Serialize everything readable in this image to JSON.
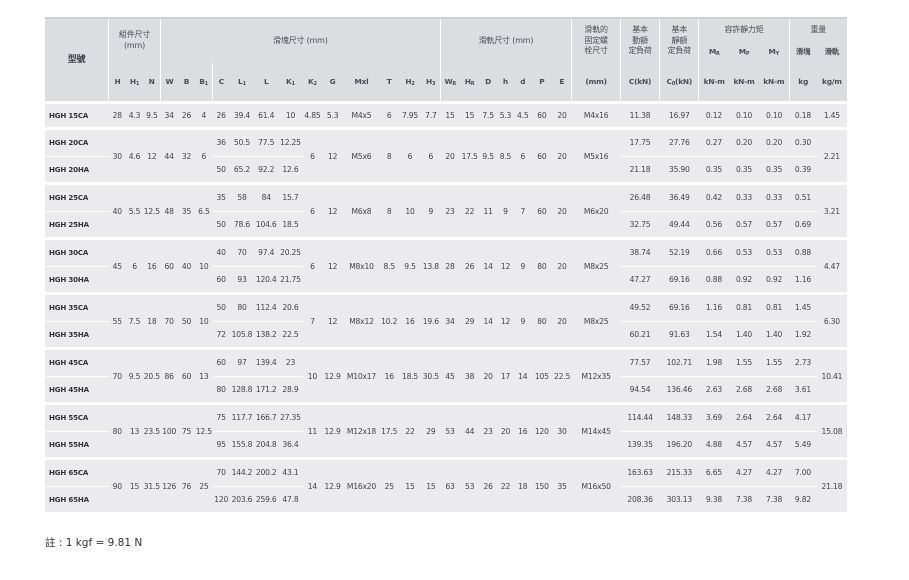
{
  "header": {
    "model": "型號",
    "assembly": "組件尺寸\n(mm)",
    "block": "滑塊尺寸 (mm)",
    "rail": "滑軌尺寸 (mm)",
    "bolt": "滑軌的\n固定螺\n栓尺寸",
    "dynamic": "基本\n動額\n定負荷",
    "static": "基本\n靜額\n定負荷",
    "moment": "容許靜力矩",
    "weight": "重量",
    "block_w": "滑塊",
    "rail_w": "滑軌",
    "mr": "MR",
    "mp": "MP",
    "my": "MY"
  },
  "columns": [
    "H",
    "H1",
    "N",
    "W",
    "B",
    "B1",
    "C",
    "L1",
    "L",
    "K1",
    "K2",
    "G",
    "Mxl",
    "T",
    "H2",
    "H3",
    "WR",
    "HR",
    "D",
    "h",
    "d",
    "P",
    "E",
    "(mm)",
    "C(kN)",
    "C0(kN)",
    "kN-m",
    "kN-m",
    "kN-m",
    "kg",
    "kg/m"
  ],
  "groups": [
    {
      "rows": [
        [
          "HGH 15CA",
          "28",
          "4.3",
          "9.5",
          "34",
          "26",
          "4",
          "26",
          "39.4",
          "61.4",
          "10",
          "4.85",
          "5.3",
          "M4x5",
          "6",
          "7.95",
          "7.7",
          "15",
          "15",
          "7.5",
          "5.3",
          "4.5",
          "60",
          "20",
          "M4x16",
          "11.38",
          "16.97",
          "0.12",
          "0.10",
          "0.10",
          "0.18",
          "1.45"
        ]
      ]
    },
    {
      "shared": {
        "H": "30",
        "H1": "4.6",
        "N": "12",
        "W": "44",
        "B": "32",
        "B1": "6",
        "K2": "6",
        "G": "12",
        "Mxl": "M5x6",
        "T": "8",
        "H2": "6",
        "H3": "6",
        "WR": "20",
        "HR": "17.5",
        "D": "9.5",
        "h": "8.5",
        "d": "6",
        "P": "60",
        "E": "20",
        "bolt": "M5x16",
        "rail_w": "2.21"
      },
      "rows": [
        {
          "model": "HGH 20CA",
          "C": "36",
          "L1": "50.5",
          "L": "77.5",
          "K1": "12.25",
          "Cd": "17.75",
          "C0": "27.76",
          "MR": "0.27",
          "MP": "0.20",
          "MY": "0.20",
          "kg": "0.30"
        },
        {
          "model": "HGH 20HA",
          "C": "50",
          "L1": "65.2",
          "L": "92.2",
          "K1": "12.6",
          "Cd": "21.18",
          "C0": "35.90",
          "MR": "0.35",
          "MP": "0.35",
          "MY": "0.35",
          "kg": "0.39"
        }
      ]
    },
    {
      "shared": {
        "H": "40",
        "H1": "5.5",
        "N": "12.5",
        "W": "48",
        "B": "35",
        "B1": "6.5",
        "K2": "6",
        "G": "12",
        "Mxl": "M6x8",
        "T": "8",
        "H2": "10",
        "H3": "9",
        "WR": "23",
        "HR": "22",
        "D": "11",
        "h": "9",
        "d": "7",
        "P": "60",
        "E": "20",
        "bolt": "M6x20",
        "rail_w": "3.21"
      },
      "rows": [
        {
          "model": "HGH 25CA",
          "C": "35",
          "L1": "58",
          "L": "84",
          "K1": "15.7",
          "Cd": "26.48",
          "C0": "36.49",
          "MR": "0.42",
          "MP": "0.33",
          "MY": "0.33",
          "kg": "0.51"
        },
        {
          "model": "HGH 25HA",
          "C": "50",
          "L1": "78.6",
          "L": "104.6",
          "K1": "18.5",
          "Cd": "32.75",
          "C0": "49.44",
          "MR": "0.56",
          "MP": "0.57",
          "MY": "0.57",
          "kg": "0.69"
        }
      ]
    },
    {
      "shared": {
        "H": "45",
        "H1": "6",
        "N": "16",
        "W": "60",
        "B": "40",
        "B1": "10",
        "K2": "6",
        "G": "12",
        "Mxl": "M8x10",
        "T": "8.5",
        "H2": "9.5",
        "H3": "13.8",
        "WR": "28",
        "HR": "26",
        "D": "14",
        "h": "12",
        "d": "9",
        "P": "80",
        "E": "20",
        "bolt": "M8x25",
        "rail_w": "4.47"
      },
      "rows": [
        {
          "model": "HGH 30CA",
          "C": "40",
          "L1": "70",
          "L": "97.4",
          "K1": "20.25",
          "Cd": "38.74",
          "C0": "52.19",
          "MR": "0.66",
          "MP": "0.53",
          "MY": "0.53",
          "kg": "0.88"
        },
        {
          "model": "HGH 30HA",
          "C": "60",
          "L1": "93",
          "L": "120.4",
          "K1": "21.75",
          "Cd": "47.27",
          "C0": "69.16",
          "MR": "0.88",
          "MP": "0.92",
          "MY": "0.92",
          "kg": "1.16"
        }
      ]
    },
    {
      "shared": {
        "H": "55",
        "H1": "7.5",
        "N": "18",
        "W": "70",
        "B": "50",
        "B1": "10",
        "K2": "7",
        "G": "12",
        "Mxl": "M8x12",
        "T": "10.2",
        "H2": "16",
        "H3": "19.6",
        "WR": "34",
        "HR": "29",
        "D": "14",
        "h": "12",
        "d": "9",
        "P": "80",
        "E": "20",
        "bolt": "M8x25",
        "rail_w": "6.30"
      },
      "rows": [
        {
          "model": "HGH 35CA",
          "C": "50",
          "L1": "80",
          "L": "112.4",
          "K1": "20.6",
          "Cd": "49.52",
          "C0": "69.16",
          "MR": "1.16",
          "MP": "0.81",
          "MY": "0.81",
          "kg": "1.45"
        },
        {
          "model": "HGH 35HA",
          "C": "72",
          "L1": "105.8",
          "L": "138.2",
          "K1": "22.5",
          "Cd": "60.21",
          "C0": "91.63",
          "MR": "1.54",
          "MP": "1.40",
          "MY": "1.40",
          "kg": "1.92"
        }
      ]
    },
    {
      "shared": {
        "H": "70",
        "H1": "9.5",
        "N": "20.5",
        "W": "86",
        "B": "60",
        "B1": "13",
        "K2": "10",
        "G": "12.9",
        "Mxl": "M10x17",
        "T": "16",
        "H2": "18.5",
        "H3": "30.5",
        "WR": "45",
        "HR": "38",
        "D": "20",
        "h": "17",
        "d": "14",
        "P": "105",
        "E": "22.5",
        "bolt": "M12x35",
        "rail_w": "10.41"
      },
      "rows": [
        {
          "model": "HGH 45CA",
          "C": "60",
          "L1": "97",
          "L": "139.4",
          "K1": "23",
          "Cd": "77.57",
          "C0": "102.71",
          "MR": "1.98",
          "MP": "1.55",
          "MY": "1.55",
          "kg": "2.73"
        },
        {
          "model": "HGH 45HA",
          "C": "80",
          "L1": "128.8",
          "L": "171.2",
          "K1": "28.9",
          "Cd": "94.54",
          "C0": "136.46",
          "MR": "2.63",
          "MP": "2.68",
          "MY": "2.68",
          "kg": "3.61"
        }
      ]
    },
    {
      "shared": {
        "H": "80",
        "H1": "13",
        "N": "23.5",
        "W": "100",
        "B": "75",
        "B1": "12.5",
        "K2": "11",
        "G": "12.9",
        "Mxl": "M12x18",
        "T": "17.5",
        "H2": "22",
        "H3": "29",
        "WR": "53",
        "HR": "44",
        "D": "23",
        "h": "20",
        "d": "16",
        "P": "120",
        "E": "30",
        "bolt": "M14x45",
        "rail_w": "15.08"
      },
      "rows": [
        {
          "model": "HGH 55CA",
          "C": "75",
          "L1": "117.7",
          "L": "166.7",
          "K1": "27.35",
          "Cd": "114.44",
          "C0": "148.33",
          "MR": "3.69",
          "MP": "2.64",
          "MY": "2.64",
          "kg": "4.17"
        },
        {
          "model": "HGH 55HA",
          "C": "95",
          "L1": "155.8",
          "L": "204.8",
          "K1": "36.4",
          "Cd": "139.35",
          "C0": "196.20",
          "MR": "4.88",
          "MP": "4.57",
          "MY": "4.57",
          "kg": "5.49"
        }
      ]
    },
    {
      "shared": {
        "H": "90",
        "H1": "15",
        "N": "31.5",
        "W": "126",
        "B": "76",
        "B1": "25",
        "K2": "14",
        "G": "12.9",
        "Mxl": "M16x20",
        "T": "25",
        "H2": "15",
        "H3": "15",
        "WR": "63",
        "HR": "53",
        "D": "26",
        "h": "22",
        "d": "18",
        "P": "150",
        "E": "35",
        "bolt": "M16x50",
        "rail_w": "21.18"
      },
      "rows": [
        {
          "model": "HGH 65CA",
          "C": "70",
          "L1": "144.2",
          "L": "200.2",
          "K1": "43.1",
          "Cd": "163.63",
          "C0": "215.33",
          "MR": "6.65",
          "MP": "4.27",
          "MY": "4.27",
          "kg": "7.00"
        },
        {
          "model": "HGH 65HA",
          "C": "120",
          "L1": "203.6",
          "L": "259.6",
          "K1": "47.8",
          "Cd": "208.36",
          "C0": "303.13",
          "MR": "9.38",
          "MP": "7.38",
          "MY": "7.38",
          "kg": "9.82"
        }
      ]
    }
  ],
  "note": "註 : 1 kgf = 9.81 N"
}
